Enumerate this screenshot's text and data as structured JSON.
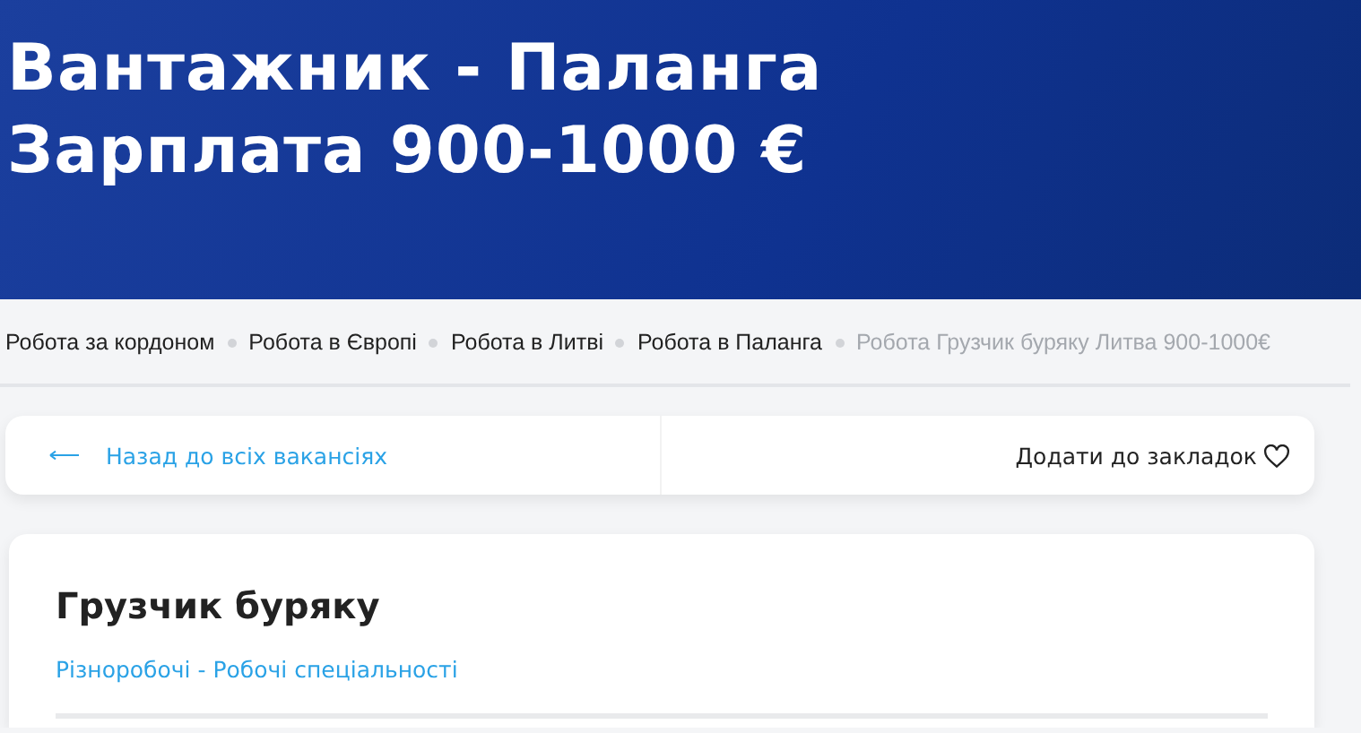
{
  "header": {
    "title_lines": [
      "Вантажник - Паланга",
      "Зарплата 900-1000 €"
    ]
  },
  "breadcrumbs": [
    {
      "label": "Робота за кордоном",
      "current": false
    },
    {
      "label": "Робота в Європі",
      "current": false
    },
    {
      "label": "Робота в Литві",
      "current": false
    },
    {
      "label": "Робота в Паланга",
      "current": false
    },
    {
      "label": "Робота Грузчик буряку Литва 900-1000€",
      "current": true
    }
  ],
  "nav": {
    "back_link": "Назад до всіх вакансіях",
    "bookmark": "Додати до закладок"
  },
  "job": {
    "title": "Грузчик буряку",
    "category": "Різноробочі - Робочі спеціальності"
  }
}
